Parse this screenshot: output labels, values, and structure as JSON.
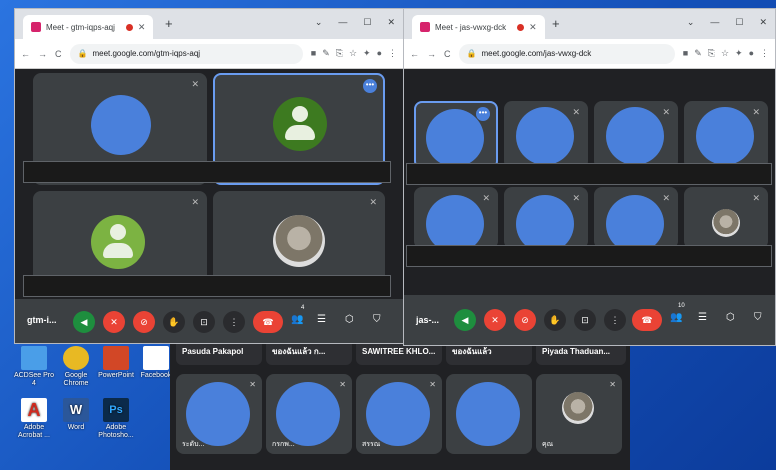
{
  "left_window": {
    "tab_title": "Meet - gtm-iqps-aqj",
    "url": "meet.google.com/gtm-iqps-aqj",
    "meeting_label": "gtm-i...",
    "participants_count": "4"
  },
  "right_window": {
    "tab_title": "Meet - jas-vwxg-dck",
    "url": "meet.google.com/jas-vwxg-dck",
    "meeting_label": "jas-...",
    "participants_count": "10"
  },
  "background_meet": {
    "names": [
      "Pasuda Pakapol",
      "ของฉันแล้ว ก...",
      "SAWITREE KHLO...",
      "ของฉันแล้ว",
      "Piyada Thaduan..."
    ],
    "tile_labels": [
      "ระดับ...",
      "กรกพ...",
      "สรรณ",
      "",
      "คุณ"
    ]
  },
  "desktop_icons": [
    {
      "label": "ACDSee Pro 4",
      "color": "#4a9ee8"
    },
    {
      "label": "Google Chrome",
      "color": "#e8b923"
    },
    {
      "label": "PowerPoint",
      "color": "#d24726"
    },
    {
      "label": "Facebook",
      "color": "#ffffff"
    },
    {
      "label": "Adobe Acrobat ...",
      "color": "#d22a1e"
    },
    {
      "label": "Word",
      "color": "#2b579a"
    },
    {
      "label": "Adobe Photosho...",
      "color": "#0b2a4a"
    }
  ],
  "icons": {
    "mic": "🎤",
    "cam": "⊘",
    "hand": "✋",
    "present": "⊡",
    "more": "⋮",
    "leave": "☎",
    "people": "👥",
    "chat": "☰",
    "activities": "⬡",
    "safety": "⛉"
  },
  "colors": {
    "active_border": "#6a9cf0",
    "avatar_blue": "#4a80db",
    "danger": "#ea4335",
    "success": "#1e8e3e"
  }
}
